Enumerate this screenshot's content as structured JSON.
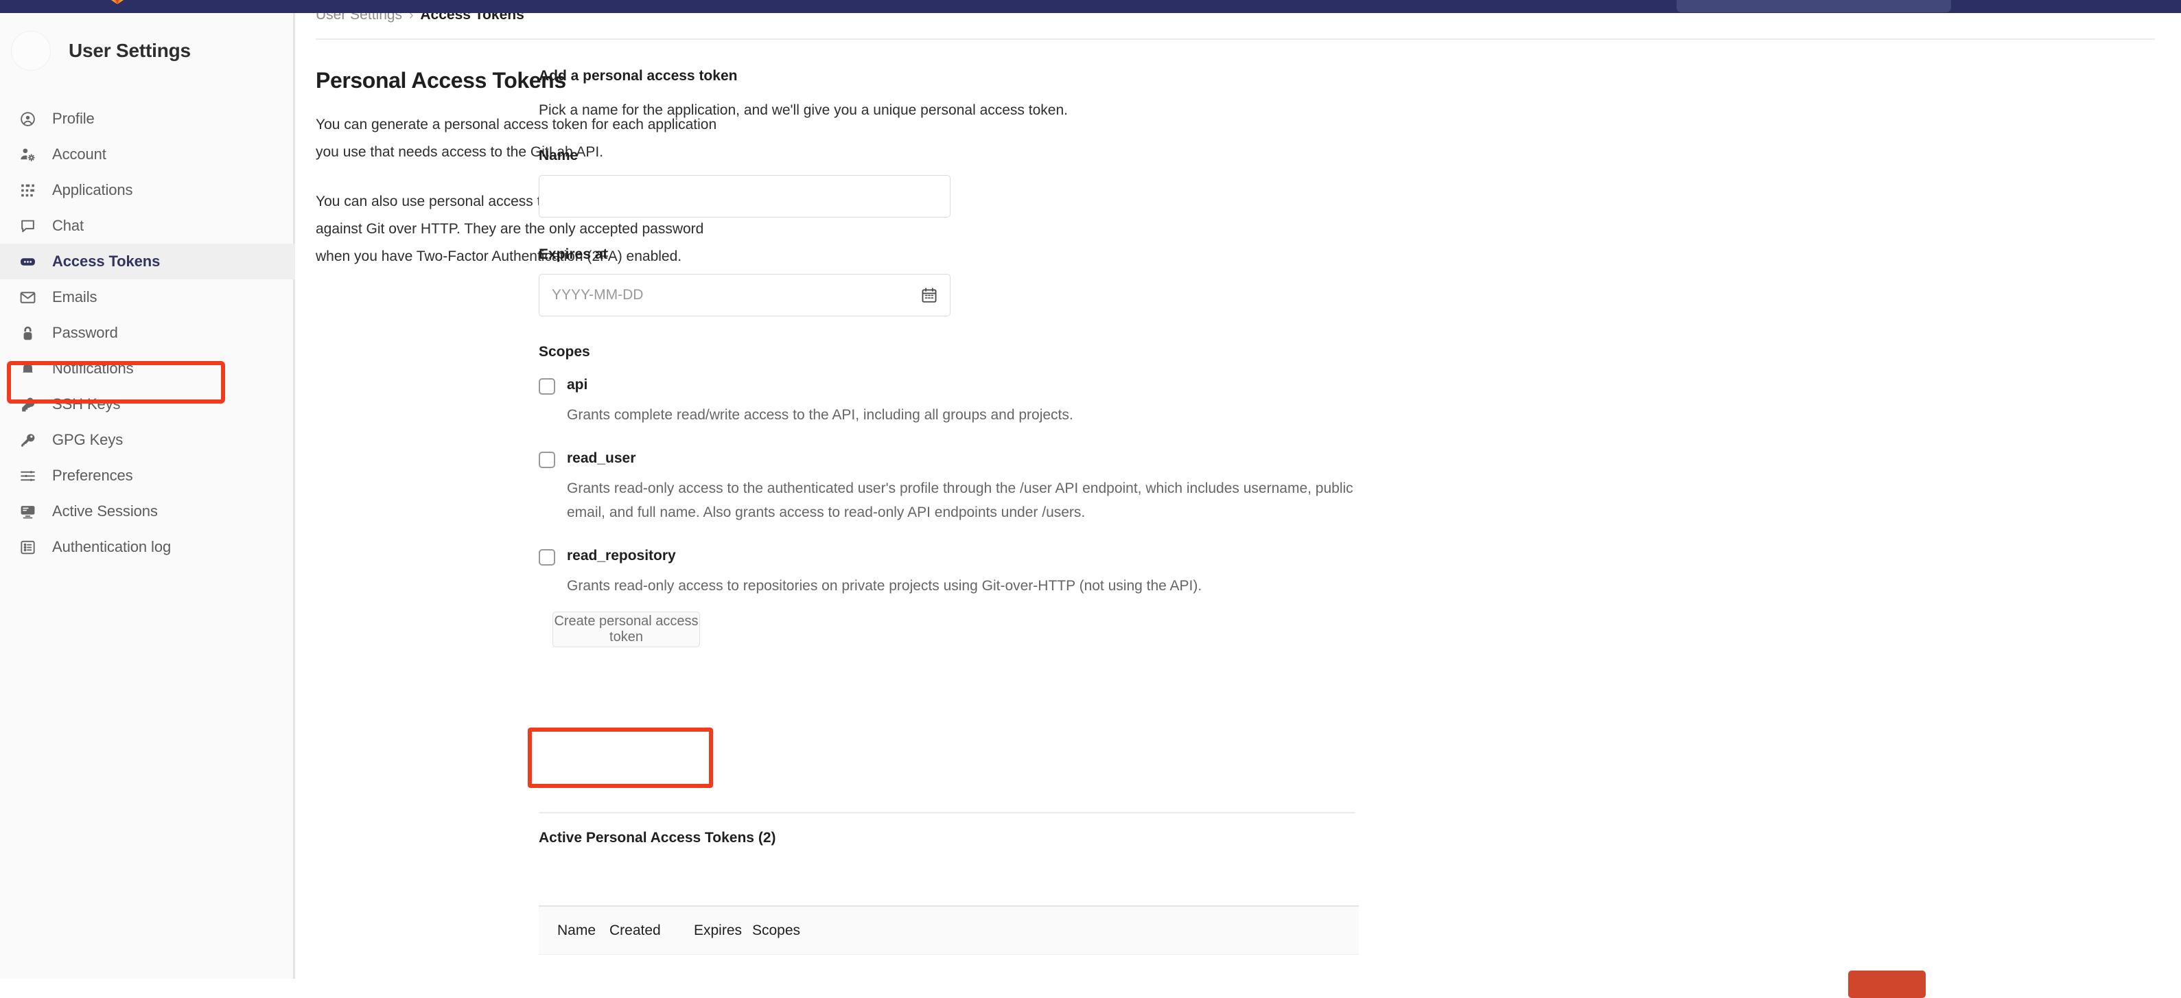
{
  "topbar": {
    "logo_icon": "gitlab-logo-icon",
    "search_placeholder": ""
  },
  "sidebar": {
    "title": "User Settings",
    "avatar_icon": "avatar",
    "items": [
      {
        "label": "Profile",
        "icon": "user-circle-icon",
        "active": false
      },
      {
        "label": "Account",
        "icon": "account-gear-icon",
        "active": false
      },
      {
        "label": "Applications",
        "icon": "apps-grid-icon",
        "active": false
      },
      {
        "label": "Chat",
        "icon": "chat-bubble-icon",
        "active": false
      },
      {
        "label": "Access Tokens",
        "icon": "token-icon",
        "active": true
      },
      {
        "label": "Emails",
        "icon": "envelope-icon",
        "active": false
      },
      {
        "label": "Password",
        "icon": "lock-icon",
        "active": false
      },
      {
        "label": "Notifications",
        "icon": "bell-icon",
        "active": false
      },
      {
        "label": "SSH Keys",
        "icon": "ssh-key-icon",
        "active": false
      },
      {
        "label": "GPG Keys",
        "icon": "gpg-key-icon",
        "active": false
      },
      {
        "label": "Preferences",
        "icon": "sliders-icon",
        "active": false
      },
      {
        "label": "Active Sessions",
        "icon": "monitor-icon",
        "active": false
      },
      {
        "label": "Authentication log",
        "icon": "log-list-icon",
        "active": false
      }
    ]
  },
  "breadcrumb": {
    "parent": "User Settings",
    "separator": "›",
    "current": "Access Tokens"
  },
  "description": {
    "title": "Personal Access Tokens",
    "paragraph1": "You can generate a personal access token for each application you use that needs access to the GitLab API.",
    "paragraph2": "You can also use personal access tokens to authenticate against Git over HTTP. They are the only accepted password when you have Two-Factor Authentication (2FA) enabled."
  },
  "form": {
    "title": "Add a personal access token",
    "subtitle": "Pick a name for the application, and we'll give you a unique personal access token.",
    "name_label": "Name",
    "name_value": "",
    "name_placeholder": "",
    "expires_label": "Expires at",
    "expires_value": "",
    "expires_placeholder": "YYYY-MM-DD",
    "calendar_icon": "calendar-icon",
    "scopes_label": "Scopes",
    "scopes": [
      {
        "name": "api",
        "checked": false,
        "description": "Grants complete read/write access to the API, including all groups and projects."
      },
      {
        "name": "read_user",
        "checked": false,
        "description": "Grants read-only access to the authenticated user's profile through the /user API endpoint, which includes username, public email, and full name. Also grants access to read-only API endpoints under /users."
      },
      {
        "name": "read_repository",
        "checked": false,
        "description": "Grants read-only access to repositories on private projects using Git-over-HTTP (not using the API)."
      }
    ],
    "create_button": "Create personal access token"
  },
  "tokens_table": {
    "title": "Active Personal Access Tokens (2)",
    "count": 2,
    "columns": [
      "Name",
      "Created",
      "Expires",
      "Scopes"
    ],
    "rows": [],
    "revoke_button_label": ""
  },
  "colors": {
    "topbar_navy": "#2b2f63",
    "topbar_search": "#43487a",
    "annotation_red": "#f23a1f",
    "revoke_red": "#cf462c",
    "active_nav_text": "#32345e",
    "sidebar_bg": "#fafafa",
    "active_row_bg": "#efefef"
  }
}
